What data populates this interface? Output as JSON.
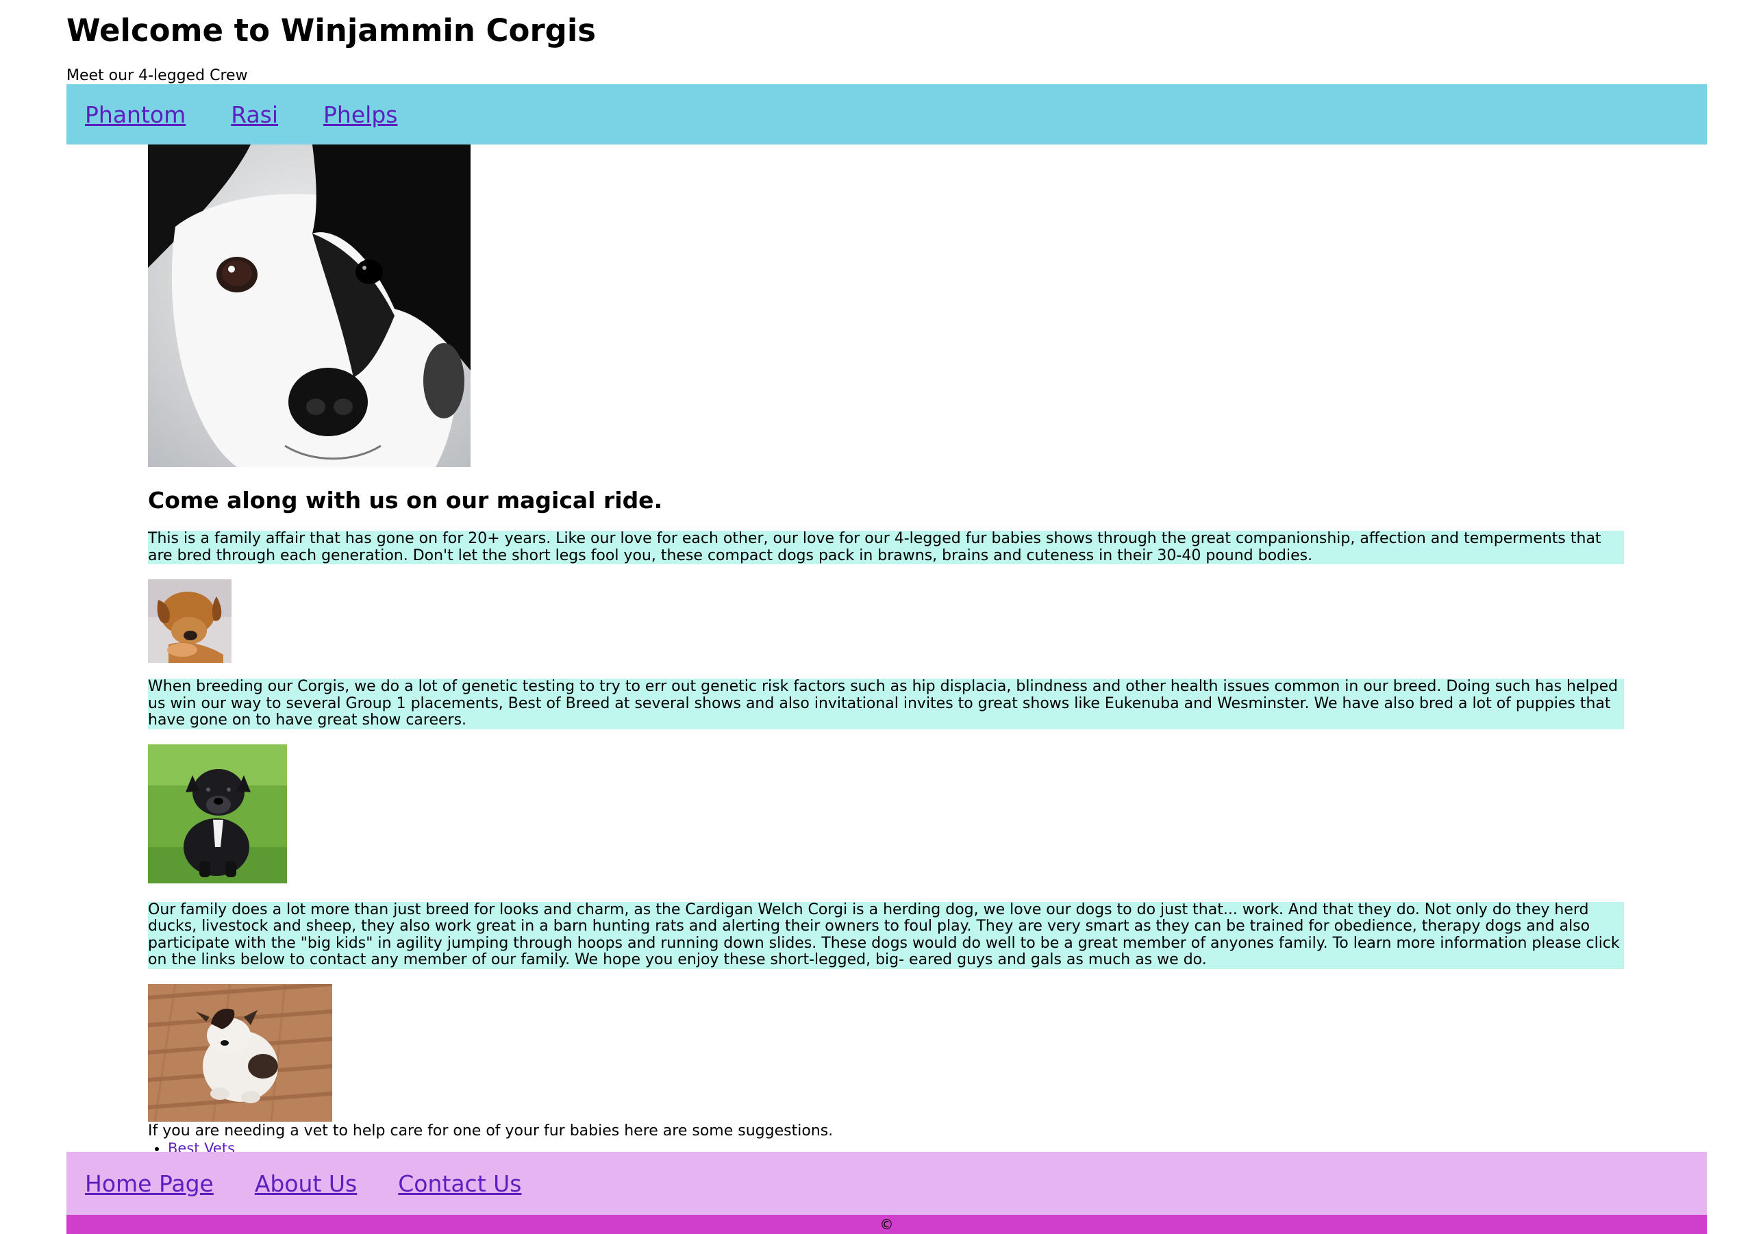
{
  "header": {
    "title": "Welcome to Winjammin Corgis",
    "subtitle": "Meet our 4-legged Crew"
  },
  "top_nav": {
    "links": [
      "Phantom",
      "Rasi",
      "Phelps"
    ]
  },
  "main": {
    "heading": "Come along with us on our magical ride.",
    "paragraphs": [
      "This is a family affair that has gone on for 20+ years. Like our love for each other, our love for our 4-legged fur babies shows through the great companionship, affection and temperments that are bred through each generation. Don't let the short legs fool you, these compact dogs pack in brawns, brains and cuteness in their 30-40 pound bodies.",
      "When breeding our Corgis, we do a lot of genetic testing to try to err out genetic risk factors such as hip displacia, blindness and other health issues common in our breed. Doing such has helped us win our way to several Group 1 placements, Best of Breed at several shows and also invitational invites to great shows like Eukenuba and Wesminster. We have also bred a lot of puppies that have gone on to have great show careers.",
      "Our family does a lot more than just breed for looks and charm, as the Cardigan Welch Corgi is a herding dog, we love our dogs to do just that... work. And that they do. Not only do they herd ducks, livestock and sheep, they also work great in a barn hunting rats and alerting their owners to foul play. They are very smart as they can be trained for obedience, therapy dogs and also participate with the \"big kids\" in agility jumping through hoops and running down slides. These dogs would do well to be a great member of anyones family. To learn more information please click on the links below to contact any member of our family. We hope you enjoy these short-legged, big- eared guys and gals as much as we do."
    ],
    "vet_intro": "If you are needing a vet to help care for one of your fur babies here are some suggestions.",
    "vet_links": [
      "Best Vets"
    ]
  },
  "footer_nav": {
    "links": [
      "Home Page",
      "About Us",
      "Contact Us"
    ]
  },
  "footer": {
    "copyright": "©"
  },
  "colors": {
    "top_nav_bg": "#79d3e4",
    "paragraph_bg": "#bff6ee",
    "footer_nav_bg": "#e6b4f1",
    "copyright_bg": "#cf3fcc",
    "link": "#5b1fbf"
  }
}
